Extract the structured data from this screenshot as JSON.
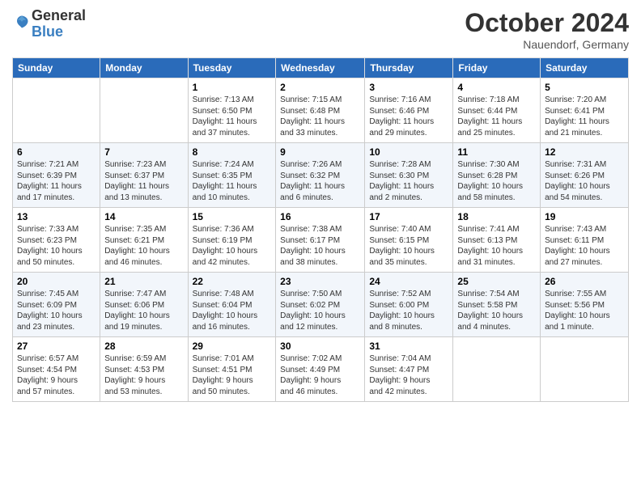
{
  "header": {
    "logo_general": "General",
    "logo_blue": "Blue",
    "month_title": "October 2024",
    "location": "Nauendorf, Germany"
  },
  "weekdays": [
    "Sunday",
    "Monday",
    "Tuesday",
    "Wednesday",
    "Thursday",
    "Friday",
    "Saturday"
  ],
  "weeks": [
    [
      {
        "day": "",
        "info": ""
      },
      {
        "day": "",
        "info": ""
      },
      {
        "day": "1",
        "info": "Sunrise: 7:13 AM\nSunset: 6:50 PM\nDaylight: 11 hours\nand 37 minutes."
      },
      {
        "day": "2",
        "info": "Sunrise: 7:15 AM\nSunset: 6:48 PM\nDaylight: 11 hours\nand 33 minutes."
      },
      {
        "day": "3",
        "info": "Sunrise: 7:16 AM\nSunset: 6:46 PM\nDaylight: 11 hours\nand 29 minutes."
      },
      {
        "day": "4",
        "info": "Sunrise: 7:18 AM\nSunset: 6:44 PM\nDaylight: 11 hours\nand 25 minutes."
      },
      {
        "day": "5",
        "info": "Sunrise: 7:20 AM\nSunset: 6:41 PM\nDaylight: 11 hours\nand 21 minutes."
      }
    ],
    [
      {
        "day": "6",
        "info": "Sunrise: 7:21 AM\nSunset: 6:39 PM\nDaylight: 11 hours\nand 17 minutes."
      },
      {
        "day": "7",
        "info": "Sunrise: 7:23 AM\nSunset: 6:37 PM\nDaylight: 11 hours\nand 13 minutes."
      },
      {
        "day": "8",
        "info": "Sunrise: 7:24 AM\nSunset: 6:35 PM\nDaylight: 11 hours\nand 10 minutes."
      },
      {
        "day": "9",
        "info": "Sunrise: 7:26 AM\nSunset: 6:32 PM\nDaylight: 11 hours\nand 6 minutes."
      },
      {
        "day": "10",
        "info": "Sunrise: 7:28 AM\nSunset: 6:30 PM\nDaylight: 11 hours\nand 2 minutes."
      },
      {
        "day": "11",
        "info": "Sunrise: 7:30 AM\nSunset: 6:28 PM\nDaylight: 10 hours\nand 58 minutes."
      },
      {
        "day": "12",
        "info": "Sunrise: 7:31 AM\nSunset: 6:26 PM\nDaylight: 10 hours\nand 54 minutes."
      }
    ],
    [
      {
        "day": "13",
        "info": "Sunrise: 7:33 AM\nSunset: 6:23 PM\nDaylight: 10 hours\nand 50 minutes."
      },
      {
        "day": "14",
        "info": "Sunrise: 7:35 AM\nSunset: 6:21 PM\nDaylight: 10 hours\nand 46 minutes."
      },
      {
        "day": "15",
        "info": "Sunrise: 7:36 AM\nSunset: 6:19 PM\nDaylight: 10 hours\nand 42 minutes."
      },
      {
        "day": "16",
        "info": "Sunrise: 7:38 AM\nSunset: 6:17 PM\nDaylight: 10 hours\nand 38 minutes."
      },
      {
        "day": "17",
        "info": "Sunrise: 7:40 AM\nSunset: 6:15 PM\nDaylight: 10 hours\nand 35 minutes."
      },
      {
        "day": "18",
        "info": "Sunrise: 7:41 AM\nSunset: 6:13 PM\nDaylight: 10 hours\nand 31 minutes."
      },
      {
        "day": "19",
        "info": "Sunrise: 7:43 AM\nSunset: 6:11 PM\nDaylight: 10 hours\nand 27 minutes."
      }
    ],
    [
      {
        "day": "20",
        "info": "Sunrise: 7:45 AM\nSunset: 6:09 PM\nDaylight: 10 hours\nand 23 minutes."
      },
      {
        "day": "21",
        "info": "Sunrise: 7:47 AM\nSunset: 6:06 PM\nDaylight: 10 hours\nand 19 minutes."
      },
      {
        "day": "22",
        "info": "Sunrise: 7:48 AM\nSunset: 6:04 PM\nDaylight: 10 hours\nand 16 minutes."
      },
      {
        "day": "23",
        "info": "Sunrise: 7:50 AM\nSunset: 6:02 PM\nDaylight: 10 hours\nand 12 minutes."
      },
      {
        "day": "24",
        "info": "Sunrise: 7:52 AM\nSunset: 6:00 PM\nDaylight: 10 hours\nand 8 minutes."
      },
      {
        "day": "25",
        "info": "Sunrise: 7:54 AM\nSunset: 5:58 PM\nDaylight: 10 hours\nand 4 minutes."
      },
      {
        "day": "26",
        "info": "Sunrise: 7:55 AM\nSunset: 5:56 PM\nDaylight: 10 hours\nand 1 minute."
      }
    ],
    [
      {
        "day": "27",
        "info": "Sunrise: 6:57 AM\nSunset: 4:54 PM\nDaylight: 9 hours\nand 57 minutes."
      },
      {
        "day": "28",
        "info": "Sunrise: 6:59 AM\nSunset: 4:53 PM\nDaylight: 9 hours\nand 53 minutes."
      },
      {
        "day": "29",
        "info": "Sunrise: 7:01 AM\nSunset: 4:51 PM\nDaylight: 9 hours\nand 50 minutes."
      },
      {
        "day": "30",
        "info": "Sunrise: 7:02 AM\nSunset: 4:49 PM\nDaylight: 9 hours\nand 46 minutes."
      },
      {
        "day": "31",
        "info": "Sunrise: 7:04 AM\nSunset: 4:47 PM\nDaylight: 9 hours\nand 42 minutes."
      },
      {
        "day": "",
        "info": ""
      },
      {
        "day": "",
        "info": ""
      }
    ]
  ]
}
